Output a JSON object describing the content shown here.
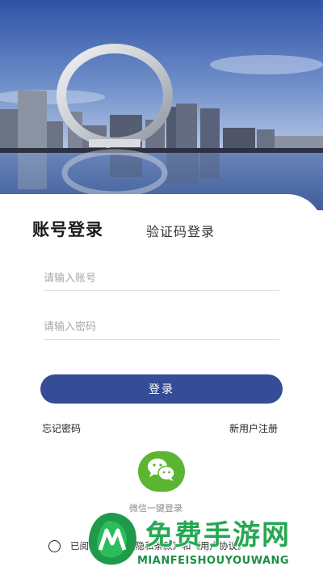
{
  "tabs": {
    "account_login": "账号登录",
    "code_login": "验证码登录"
  },
  "form": {
    "account_placeholder": "请输入账号",
    "password_placeholder": "请输入密码",
    "submit_label": "登录"
  },
  "links": {
    "forgot_password": "忘记密码",
    "register": "新用户注册"
  },
  "wechat": {
    "label": "微信一键登录"
  },
  "agreement": {
    "prefix": "已阅读并同意",
    "privacy": "《隐私条款》",
    "and": "和",
    "user": "《用户协议》"
  },
  "watermark": {
    "title": "免费手游网",
    "subtitle": "MIANFEISHOUYOUWANG"
  },
  "colors": {
    "primary": "#354c96",
    "wechat": "#5bb530",
    "watermark": "#26a852"
  },
  "icons": {
    "hero": "city-ring-landmark-photo",
    "wechat": "wechat-icon",
    "checkbox": "radio-circle-icon",
    "watermark_logo": "leaf-m-logo"
  }
}
